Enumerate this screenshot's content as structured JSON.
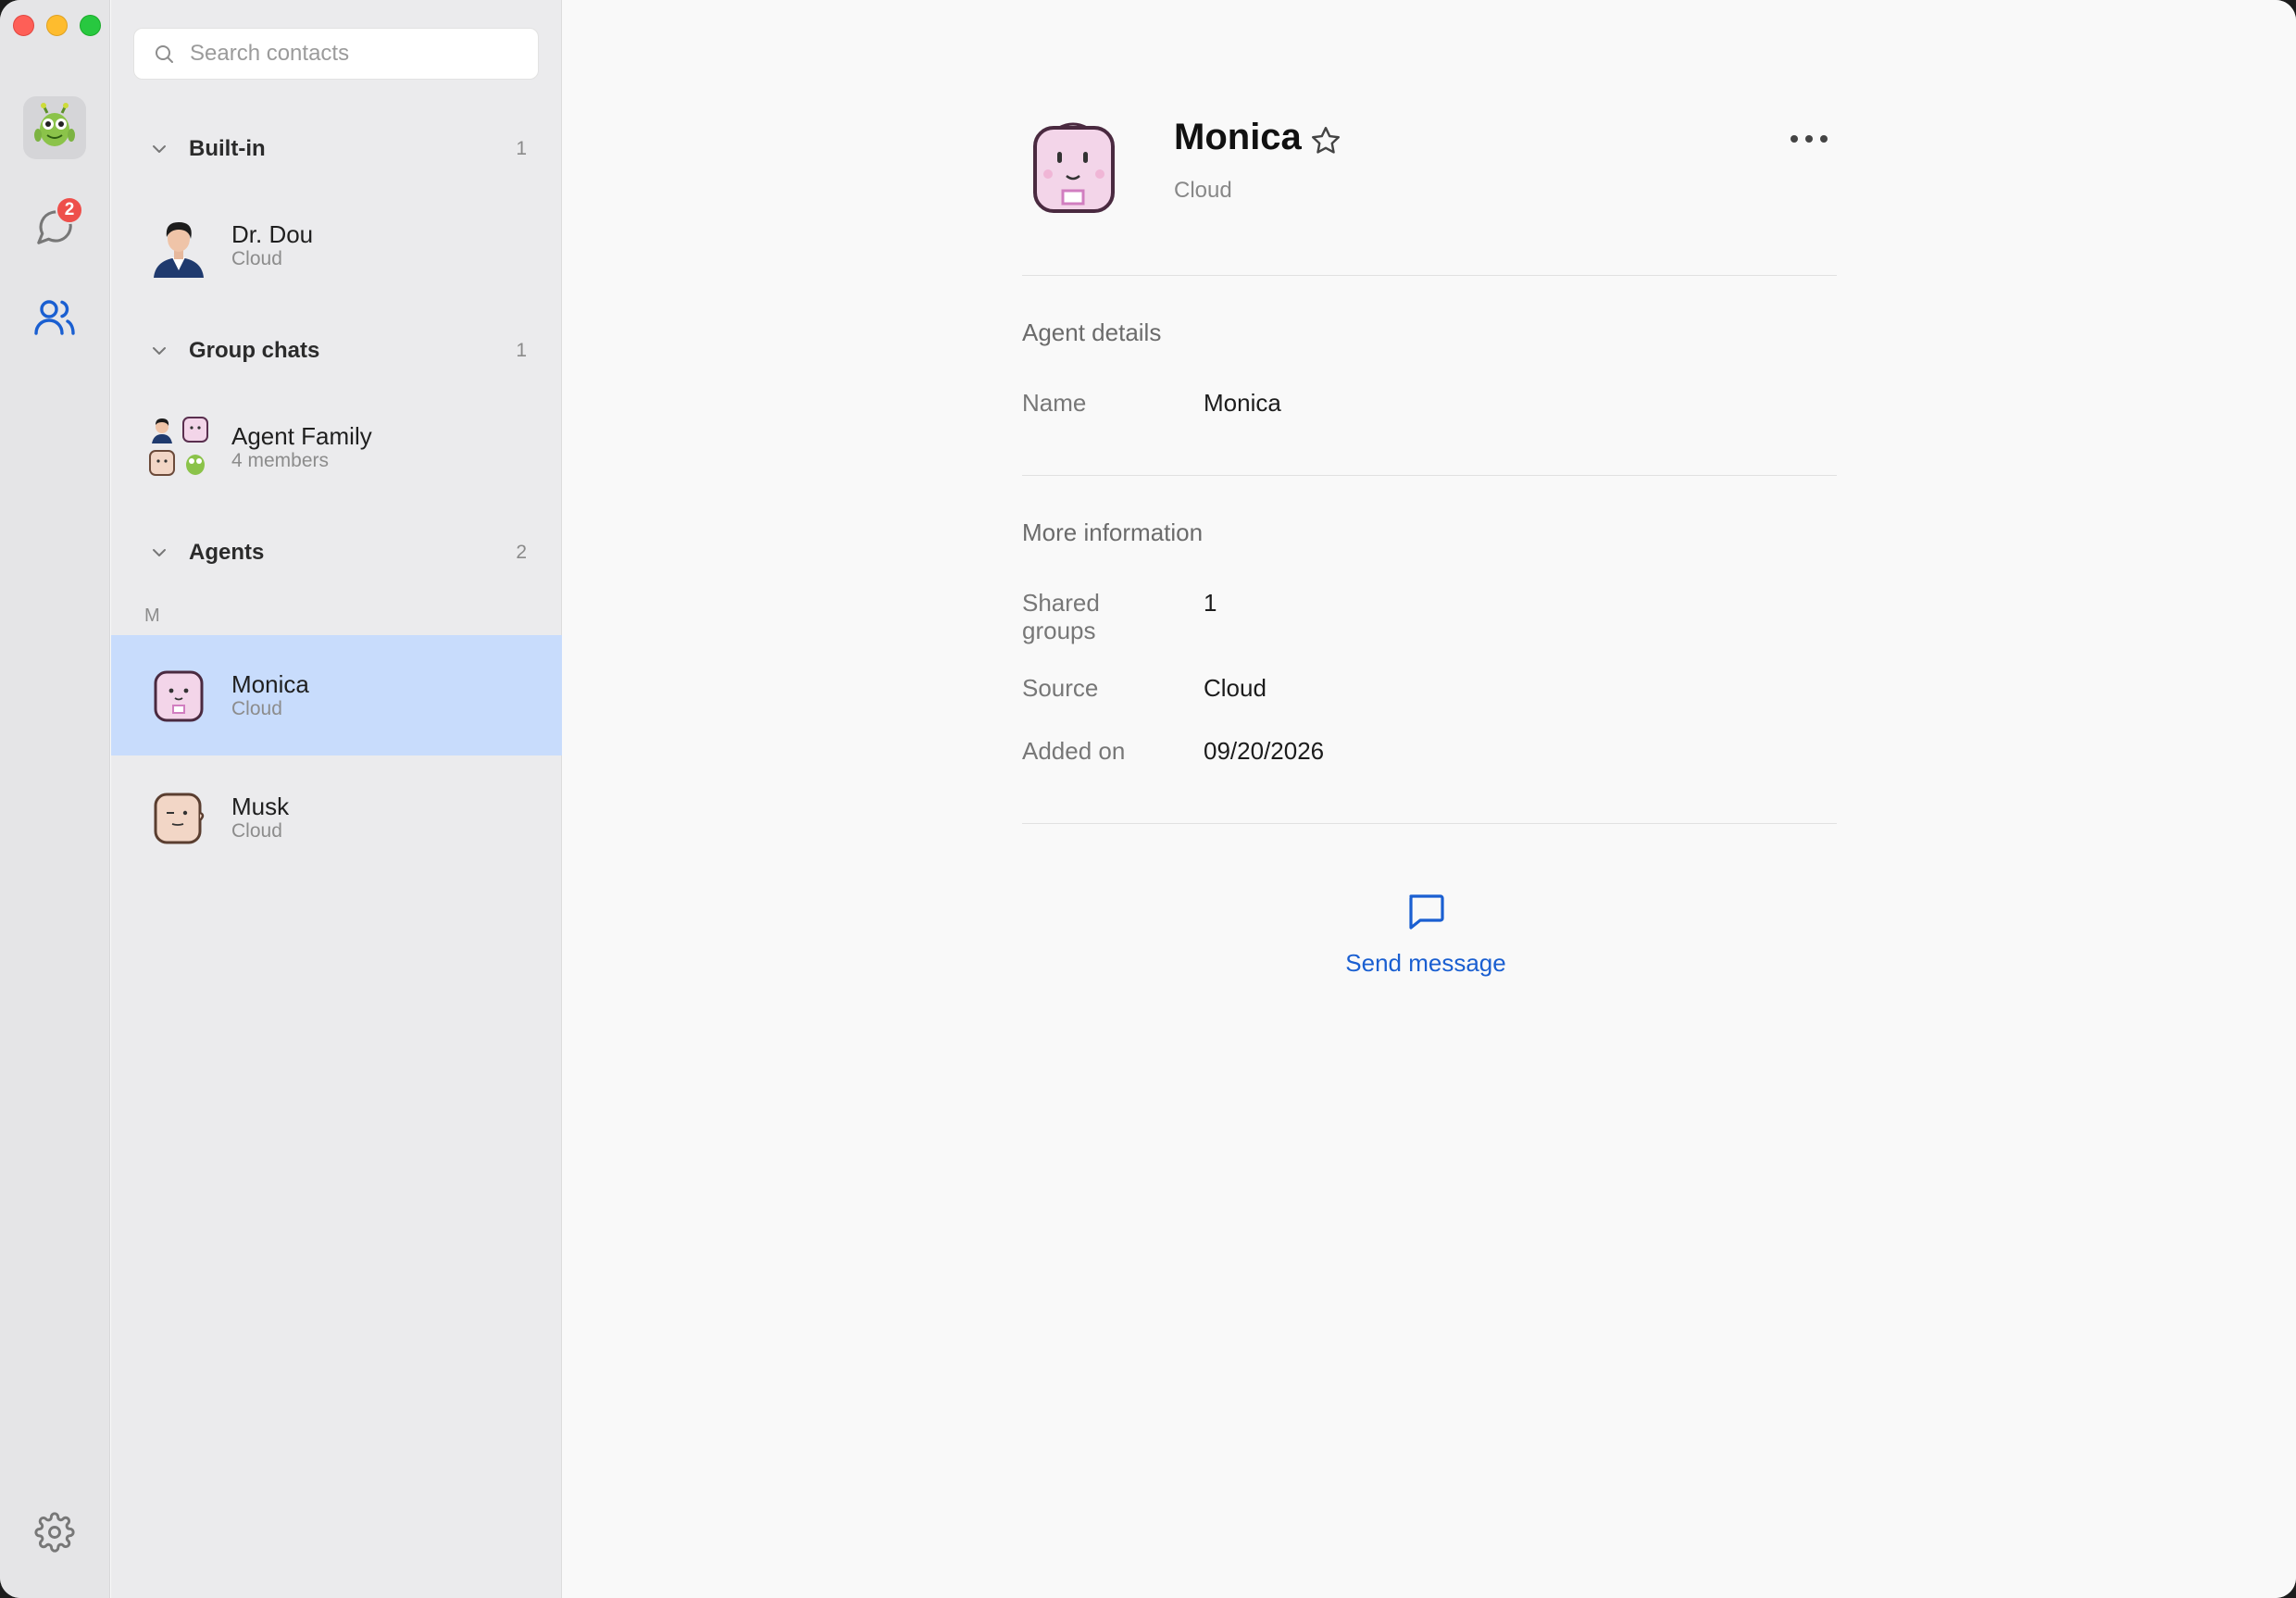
{
  "search": {
    "placeholder": "Search contacts"
  },
  "rail": {
    "chat_badge": "2"
  },
  "sections": {
    "builtin": {
      "title": "Built-in",
      "count": "1"
    },
    "groups": {
      "title": "Group chats",
      "count": "1"
    },
    "agents": {
      "title": "Agents",
      "count": "2",
      "index_letter": "M"
    }
  },
  "contacts": {
    "drdou": {
      "name": "Dr. Dou",
      "sub": "Cloud"
    },
    "family": {
      "name": "Agent Family",
      "sub": "4 members"
    },
    "monica": {
      "name": "Monica",
      "sub": "Cloud"
    },
    "musk": {
      "name": "Musk",
      "sub": "Cloud"
    }
  },
  "detail": {
    "name": "Monica",
    "source_sub": "Cloud",
    "agent_details_title": "Agent details",
    "name_label": "Name",
    "name_value": "Monica",
    "more_info_title": "More information",
    "shared_groups_label": "Shared groups",
    "shared_groups_value": "1",
    "source_label": "Source",
    "source_value": "Cloud",
    "added_on_label": "Added on",
    "added_on_value": "09/20/2026",
    "send_message_label": "Send message"
  },
  "colors": {
    "accent": "#1a5fd1",
    "selected_row": "#c8dcfc",
    "badge": "#ee4f4b"
  }
}
